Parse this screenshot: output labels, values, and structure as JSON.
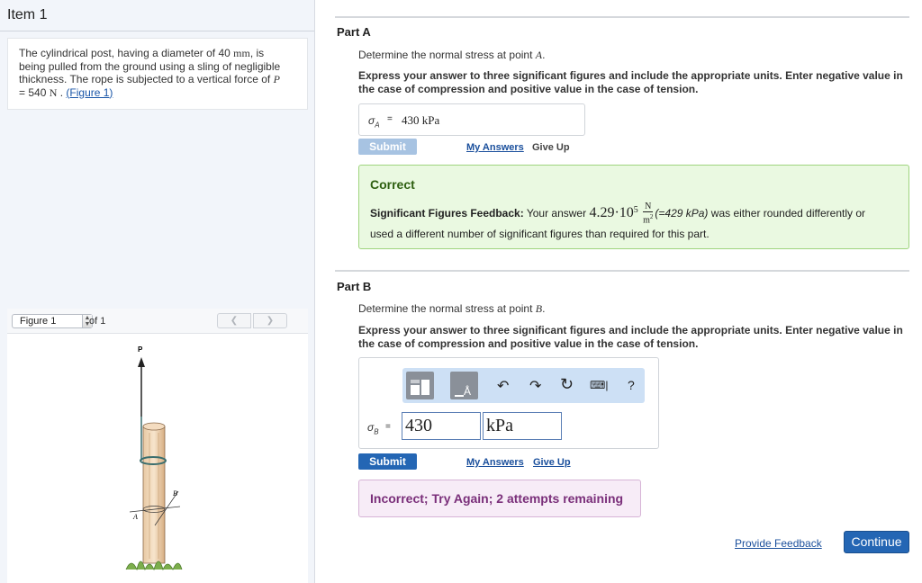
{
  "item_title": "Item 1",
  "problem": {
    "text_before_d": "The cylindrical post, having a diameter of 40",
    "d_unit": "mm",
    "text_after_d": ", is being pulled from the ground using a sling of negligible thickness. The rope is subjected to a vertical force of",
    "force_symbol": "P",
    "force_value": "= 540",
    "force_unit": "N",
    "figure_link": "(Figure 1)"
  },
  "figure": {
    "selector_label": "Figure 1",
    "of_label": "of 1",
    "prev_icon": "chevron-left-icon",
    "next_icon": "chevron-right-icon",
    "labels": {
      "p": "P",
      "a": "A",
      "b": "B"
    }
  },
  "part_a": {
    "title": "Part A",
    "question_text": "Determine the normal stress at point",
    "question_point": "A",
    "instructions": "Express your answer to three significant figures and include the appropriate units. Enter negative value in the case of compression and positive value in the case of tension.",
    "symbol": "σ",
    "symbol_sub": "A",
    "equals": "=",
    "answer": "430 kPa",
    "submit_label": "Submit",
    "my_answers": "My Answers",
    "give_up": "Give Up",
    "feedback": {
      "title": "Correct",
      "sig_label": "Significant Figures Feedback:",
      "text1": "Your answer",
      "value": "4.29·10",
      "exponent": "5",
      "unit_num": "N",
      "unit_den": "m",
      "unit_den_exp": "2",
      "kpa_note": "(=429 kPa)",
      "text2": "was either rounded differently or",
      "text3": "used a different number of significant figures than required for this part."
    }
  },
  "part_b": {
    "title": "Part B",
    "question_text": "Determine the normal stress at point",
    "question_point": "B",
    "instructions": "Express your answer to three significant figures and include the appropriate units. Enter negative value in the case of compression and positive value in the case of tension.",
    "toolbar": {
      "templates_icon": "templates-icon",
      "units_icon": "units-icon",
      "units_glyph": "Å",
      "undo_icon": "undo-icon",
      "redo_icon": "redo-icon",
      "reset_icon": "reset-icon",
      "keyboard_icon": "keyboard-icon",
      "help_label": "?"
    },
    "symbol": "σ",
    "symbol_sub": "B",
    "equals": "=",
    "value": "430",
    "unit": "kPa",
    "submit_label": "Submit",
    "my_answers": "My Answers",
    "give_up": "Give Up",
    "feedback": "Incorrect; Try Again; 2 attempts remaining"
  },
  "footer": {
    "provide_feedback": "Provide Feedback",
    "continue_label": "Continue"
  },
  "colors": {
    "submit_disabled": "#a7c3e2",
    "submit_active": "#2466b4",
    "correct_bg": "#eaf9e1",
    "incorrect_bg": "#f7ecf7",
    "link": "#1a4f9c"
  }
}
